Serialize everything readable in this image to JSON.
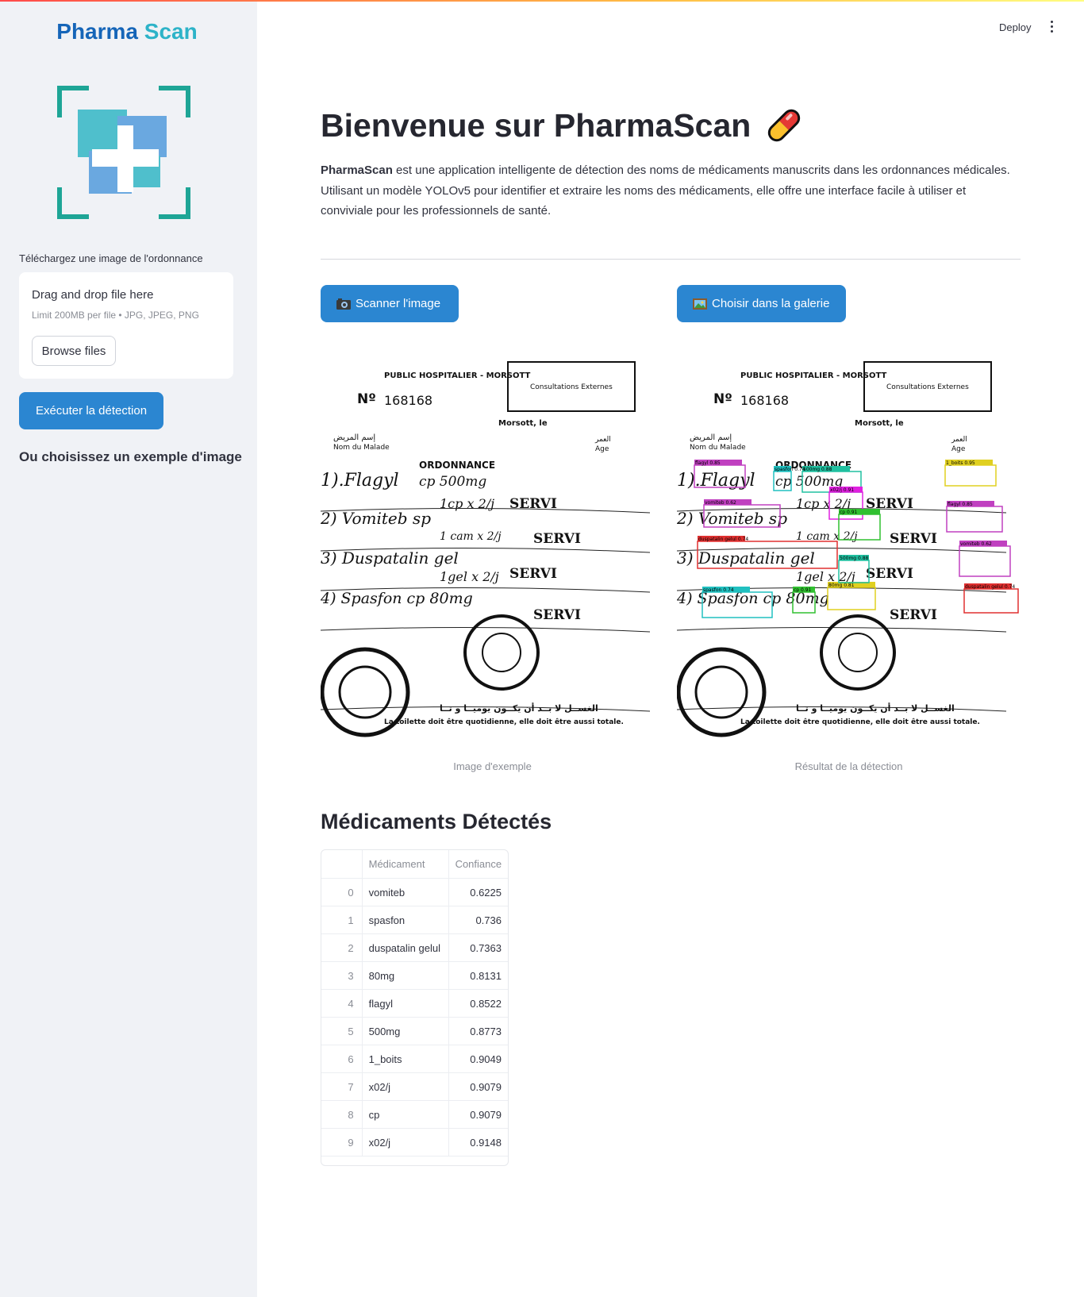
{
  "sidebar": {
    "brand_part1": "Pharma",
    "brand_part2": "Scan",
    "upload_label": "Téléchargez une image de l'ordonnance",
    "dropzone_title": "Drag and drop file here",
    "dropzone_limit": "Limit 200MB per file • JPG, JPEG, PNG",
    "browse_label": "Browse files",
    "execute_label": "Exécuter la détection",
    "example_heading": "Ou choisissez un exemple d'image"
  },
  "header": {
    "deploy_label": "Deploy",
    "menu_icon": "more-vertical-icon"
  },
  "main": {
    "title": "Bienvenue sur PharmaScan",
    "intro_bold": "PharmaScan",
    "intro_text": " est une application intelligente de détection des noms de médicaments manuscrits dans les ordonnances médicales. Utilisant un modèle YOLOv5 pour identifier et extraire les noms des médicaments, elle offre une interface facile à utiliser et conviviale pour les professionnels de santé.",
    "scan_label": "Scanner l'image",
    "gallery_label": "Choisir dans la galerie",
    "caption_example": "Image d'exemple",
    "caption_result": "Résultat de la détection",
    "section_title": "Médicaments Détectés"
  },
  "prescription": {
    "hospital": "PUBLIC HOSPITALIER - MORSOTT",
    "consult": "Consultations Externes",
    "number_prefix": "Nº",
    "number": "168168",
    "city_date": "Morsott, le",
    "patient_ar": "إسم المريض",
    "patient_fr": "Nom du Malade",
    "age_ar": "العمر",
    "age_fr": "Age",
    "ordonnance": "ORDONNANCE",
    "serv": "SERVI",
    "footer_ar": "الغســل لا بــد أن يكــون يوميــا و تــا",
    "footer_fr": "La toilette doit être quotidienne, elle doit être aussi totale."
  },
  "detections": [
    {
      "label": "flagyl 0.85",
      "color": "#c040c0"
    },
    {
      "label": "vomiteb 0.62",
      "color": "#c040c0"
    },
    {
      "label": "duspatalin gelul 0.74",
      "color": "#e03030"
    },
    {
      "label": "spasfon 0.74",
      "color": "#20c0c0"
    },
    {
      "label": "cp 0.91",
      "color": "#30c030"
    },
    {
      "label": "500mg 0.88",
      "color": "#20c0a0"
    },
    {
      "label": "x02/j 0.91",
      "color": "#e020e0"
    },
    {
      "label": "1_boits 0.95",
      "color": "#e0d020"
    },
    {
      "label": "80mg 0.81",
      "color": "#e0d020"
    }
  ],
  "table": {
    "headers": [
      "",
      "Médicament",
      "Confiance"
    ],
    "rows": [
      [
        "0",
        "vomiteb",
        "0.6225"
      ],
      [
        "1",
        "spasfon",
        "0.736"
      ],
      [
        "2",
        "duspatalin gelul",
        "0.7363"
      ],
      [
        "3",
        "80mg",
        "0.8131"
      ],
      [
        "4",
        "flagyl",
        "0.8522"
      ],
      [
        "5",
        "500mg",
        "0.8773"
      ],
      [
        "6",
        "1_boits",
        "0.9049"
      ],
      [
        "7",
        "x02/j",
        "0.9079"
      ],
      [
        "8",
        "cp",
        "0.9079"
      ],
      [
        "9",
        "x02/j",
        "0.9148"
      ]
    ]
  },
  "colors": {
    "accent_button": "#2b86d1",
    "brand_dark": "#1565b8",
    "brand_light": "#2db3c8",
    "sidebar_bg": "#f0f2f6"
  }
}
